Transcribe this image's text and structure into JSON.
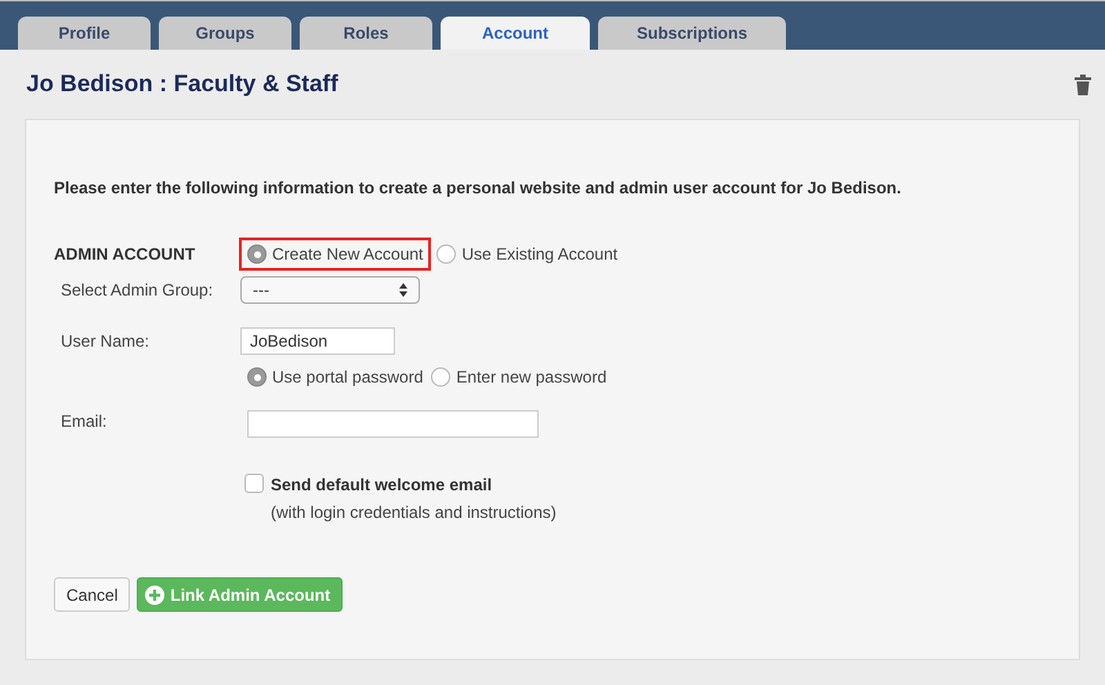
{
  "tabs": [
    {
      "label": "Profile",
      "selected": false
    },
    {
      "label": "Groups",
      "selected": false
    },
    {
      "label": "Roles",
      "selected": false
    },
    {
      "label": "Account",
      "selected": true
    },
    {
      "label": "Subscriptions",
      "selected": false
    }
  ],
  "page_title": "Jo Bedison : Faculty & Staff",
  "intro": "Please enter the following information to create a personal website and admin user account for Jo Bedison.",
  "admin_account": {
    "label": "ADMIN ACCOUNT",
    "options": [
      {
        "label": "Create New Account",
        "selected": true,
        "highlighted": true
      },
      {
        "label": "Use Existing Account",
        "selected": false,
        "highlighted": false
      }
    ]
  },
  "admin_group": {
    "label": "Select Admin Group:",
    "value": "---"
  },
  "user_name": {
    "label": "User Name:",
    "value": "JoBedison"
  },
  "password_options": [
    {
      "label": "Use portal password",
      "selected": true
    },
    {
      "label": "Enter new password",
      "selected": false
    }
  ],
  "email": {
    "label": "Email:"
  },
  "welcome_email": {
    "label": "Send default welcome email",
    "note": "(with login credentials and instructions)",
    "checked": false
  },
  "buttons": {
    "cancel": "Cancel",
    "submit": "Link Admin Account"
  }
}
